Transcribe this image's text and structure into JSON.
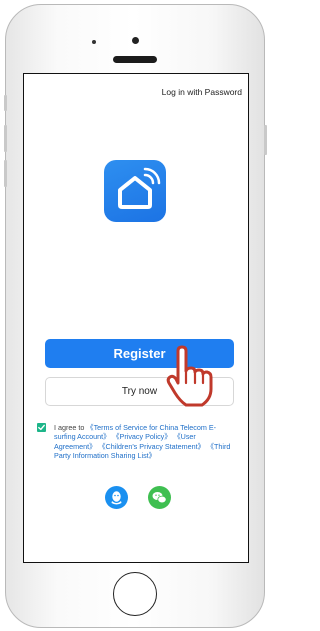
{
  "header": {
    "login_link": "Log in with Password"
  },
  "icons": {
    "app": "smart-home-icon",
    "qq": "qq-icon",
    "wechat": "wechat-icon",
    "hand": "pointing-hand-icon"
  },
  "buttons": {
    "register": "Register",
    "try_now": "Try now"
  },
  "agreement": {
    "checked": true,
    "prefix": "I agree to ",
    "link_terms": "《Terms of Service for China Telecom E-surfing Account》",
    "link_privacy": "《Privacy Policy》",
    "link_user": "《User Agreement》",
    "link_children": "《Children's Privacy Statement》",
    "link_third_party": "《Third Party Information Sharing List》"
  },
  "colors": {
    "primary": "#1f7ef0",
    "checkbox": "#1db589",
    "qq": "#1a90f0",
    "wechat": "#3fbf51",
    "hand": "#c0392b"
  }
}
